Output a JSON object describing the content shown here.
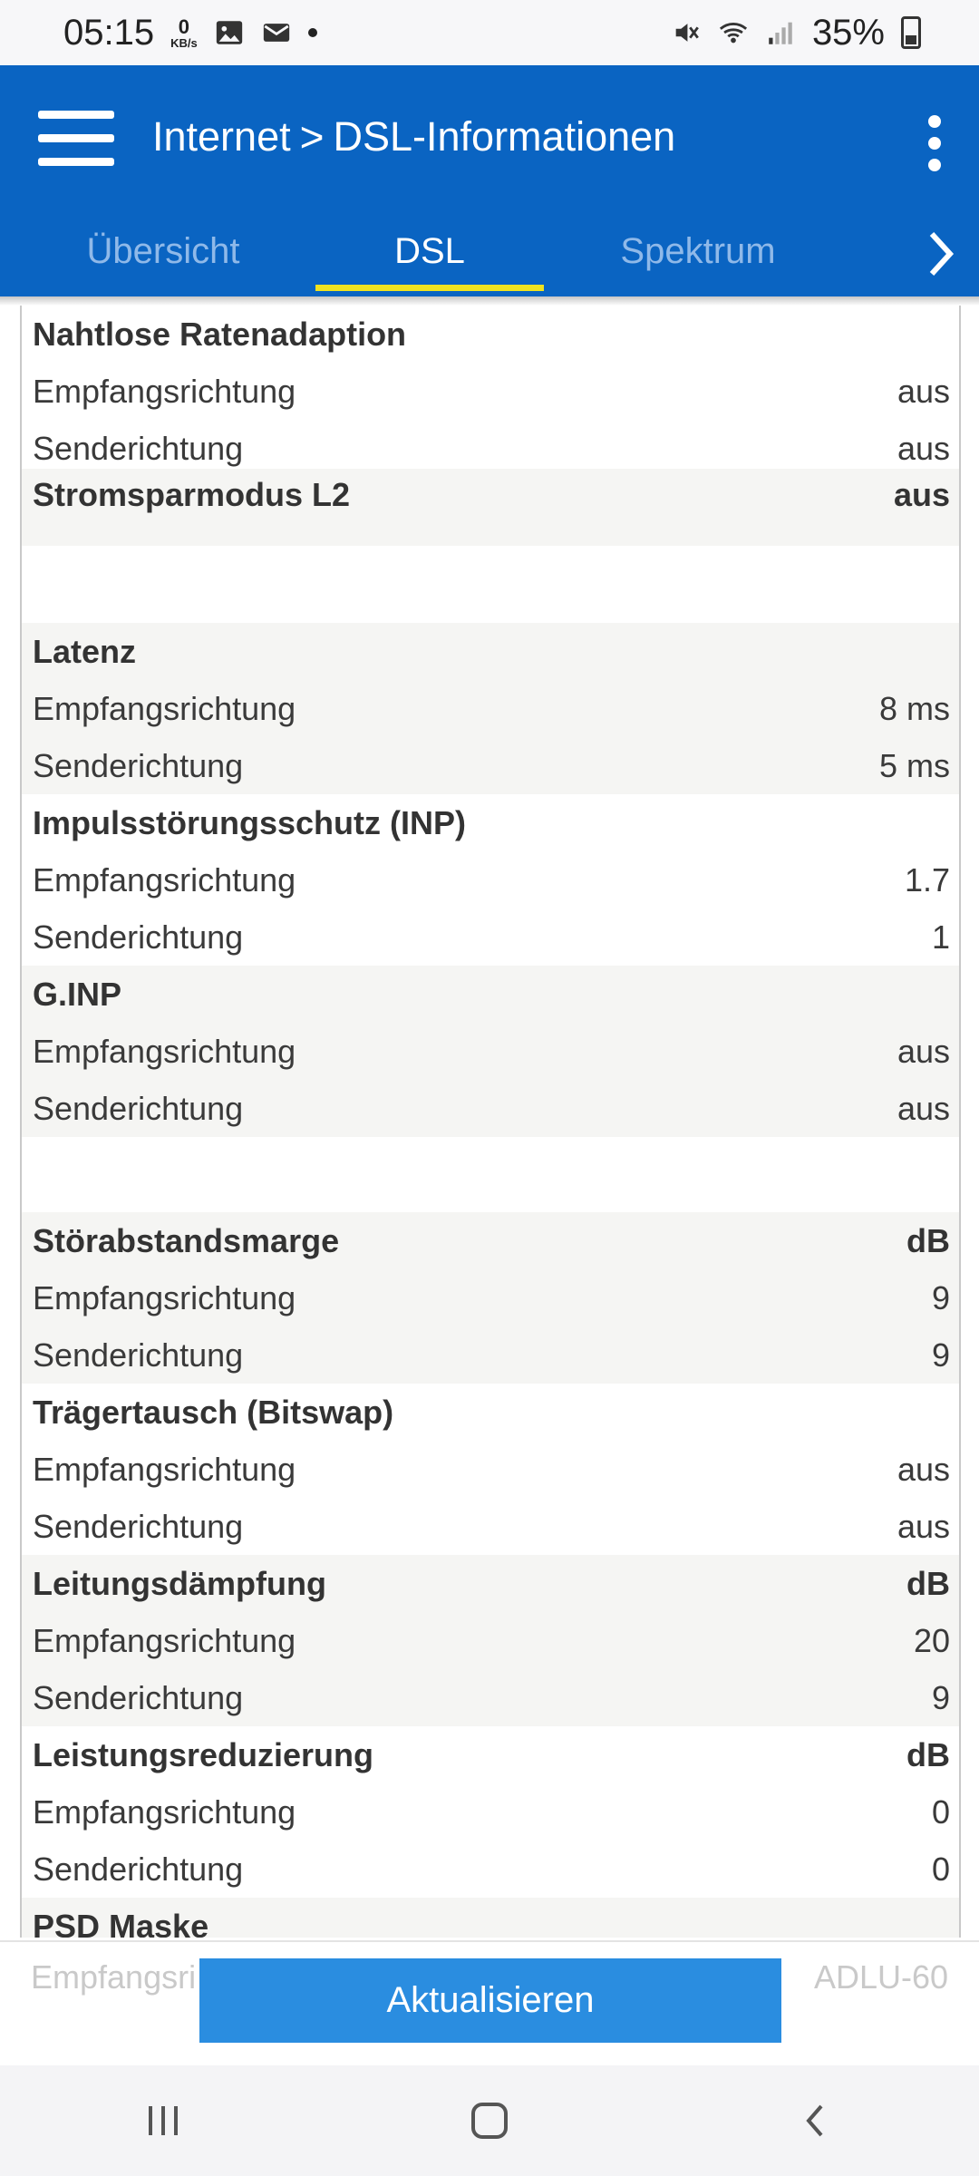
{
  "status_bar": {
    "time": "05:15",
    "speed_value": "0",
    "speed_unit": "KB/s",
    "battery": "35%",
    "icons": [
      "image-icon",
      "mail-icon",
      "mute-icon",
      "wifi-icon",
      "signal-icon",
      "battery-icon"
    ]
  },
  "appbar": {
    "crumb_1": "Internet",
    "crumb_sep": ">",
    "crumb_2": "DSL-Informationen",
    "tabs": [
      {
        "label": "Übersicht"
      },
      {
        "label": "DSL"
      },
      {
        "label": "Spektrum"
      }
    ],
    "active_tab": "DSL",
    "accent_color": "#0a64c2",
    "indicator_color": "#f0e21f"
  },
  "rows": [
    {
      "label": "Nahtlose Ratenadaption",
      "value": "",
      "type": "head"
    },
    {
      "label": "Empfangsrichtung",
      "value": "aus",
      "type": "item"
    },
    {
      "label": "Senderichtung",
      "value": "aus",
      "type": "item"
    },
    {
      "label": "Stromsparmodus L2",
      "value": "aus",
      "type": "head"
    },
    {
      "label": "Latenz",
      "value": "",
      "type": "head"
    },
    {
      "label": "Empfangsrichtung",
      "value": "8 ms",
      "type": "item"
    },
    {
      "label": "Senderichtung",
      "value": "5 ms",
      "type": "item"
    },
    {
      "label": "Impulsstörungsschutz (INP)",
      "value": "",
      "type": "head"
    },
    {
      "label": "Empfangsrichtung",
      "value": "1.7",
      "type": "item"
    },
    {
      "label": "Senderichtung",
      "value": "1",
      "type": "item"
    },
    {
      "label": "G.INP",
      "value": "",
      "type": "head"
    },
    {
      "label": "Empfangsrichtung",
      "value": "aus",
      "type": "item"
    },
    {
      "label": "Senderichtung",
      "value": "aus",
      "type": "item"
    },
    {
      "label": "Störabstandsmarge",
      "value": "dB",
      "type": "head"
    },
    {
      "label": "Empfangsrichtung",
      "value": "9",
      "type": "item"
    },
    {
      "label": "Senderichtung",
      "value": "9",
      "type": "item"
    },
    {
      "label": "Trägertausch (Bitswap)",
      "value": "",
      "type": "head"
    },
    {
      "label": "Empfangsrichtung",
      "value": "aus",
      "type": "item"
    },
    {
      "label": "Senderichtung",
      "value": "aus",
      "type": "item"
    },
    {
      "label": "Leitungsdämpfung",
      "value": "dB",
      "type": "head"
    },
    {
      "label": "Empfangsrichtung",
      "value": "20",
      "type": "item"
    },
    {
      "label": "Senderichtung",
      "value": "9",
      "type": "item"
    },
    {
      "label": "Leistungsreduzierung",
      "value": "dB",
      "type": "head"
    },
    {
      "label": "Empfangsrichtung",
      "value": "0",
      "type": "item"
    },
    {
      "label": "Senderichtung",
      "value": "0",
      "type": "item"
    },
    {
      "label": "PSD Maske",
      "value": "",
      "type": "head"
    }
  ],
  "bottom": {
    "ghost_label": "Empfangsri",
    "ghost_value": "ADLU-60",
    "refresh_label": "Aktualisieren"
  },
  "nav": [
    "recents-icon",
    "home-icon",
    "back-icon"
  ]
}
